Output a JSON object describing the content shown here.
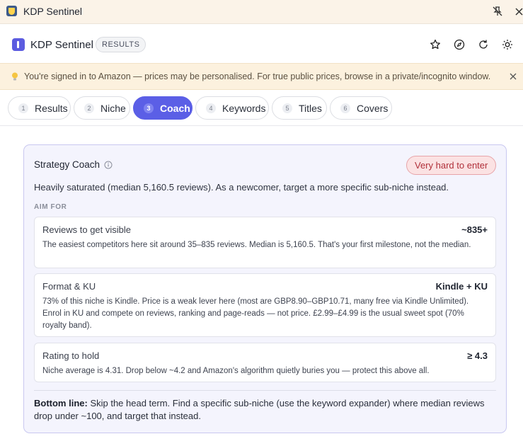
{
  "window": {
    "title": "KDP Sentinel",
    "pin_icon": "pin-off-icon",
    "close_icon": "close-icon"
  },
  "header": {
    "app_name": "KDP Sentinel",
    "badge": "RESULTS",
    "icons": [
      "star-icon",
      "compass-icon",
      "refresh-icon",
      "sun-icon"
    ]
  },
  "notice": {
    "icon": "lightbulb-icon",
    "message": "You're signed in to Amazon — prices may be personalised. For true public prices, browse in a private/incognito window."
  },
  "tabs": [
    {
      "num": "1",
      "label": "Results",
      "active": false
    },
    {
      "num": "2",
      "label": "Niche",
      "active": false
    },
    {
      "num": "3",
      "label": "Coach",
      "active": true
    },
    {
      "num": "4",
      "label": "Keywords",
      "active": false
    },
    {
      "num": "5",
      "label": "Titles",
      "active": false
    },
    {
      "num": "6",
      "label": "Covers",
      "active": false
    }
  ],
  "coach": {
    "title": "Strategy Coach",
    "difficulty": "Very hard to enter",
    "summary": "Heavily saturated (median 5,160.5 reviews). As a newcomer, target a more specific sub-niche instead.",
    "aim_label": "AIM FOR",
    "items": [
      {
        "label": "Reviews to get visible",
        "value": "~835+",
        "desc": "The easiest competitors here sit around 35–835 reviews. Median is 5,160.5. That's your first milestone, not the median."
      },
      {
        "label": "Format & KU",
        "value": "Kindle + KU",
        "desc": "73% of this niche is Kindle. Price is a weak lever here (most are GBP8.90–GBP10.71, many free via Kindle Unlimited). Enrol in KU and compete on reviews, ranking and page-reads — not price. £2.99–£4.99 is the usual sweet spot (70% royalty band)."
      },
      {
        "label": "Rating to hold",
        "value": "≥ 4.3",
        "desc": "Niche average is 4.31. Drop below ~4.2 and Amazon's algorithm quietly buries you — protect this above all."
      }
    ],
    "bottom_line_label": "Bottom line:",
    "bottom_line_text": " Skip the head term. Find a specific sub-niche (use the keyword expander) where median reviews drop under ~100, and target that instead."
  },
  "colors": {
    "accent": "#5b5fe6",
    "danger_bg": "#fbe2e3",
    "danger_text": "#b0303a",
    "notice_bg": "#fcf1de"
  }
}
